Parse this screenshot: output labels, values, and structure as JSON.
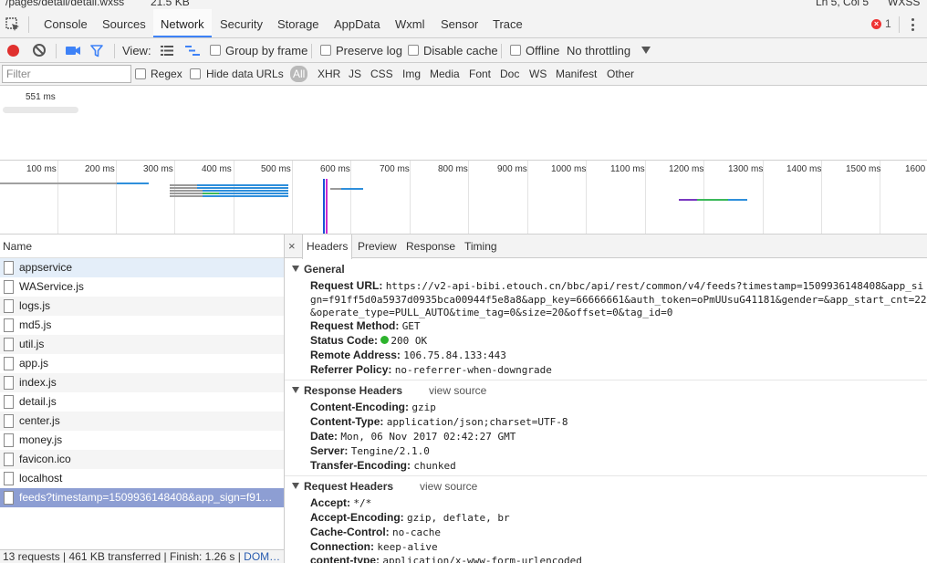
{
  "top_strip": {
    "path": "/pages/detail/detail.wxss",
    "size": "21.5 KB",
    "cursor": "Ln 5, Col 5",
    "lang": "WXSS"
  },
  "tabs": [
    {
      "label": "Console"
    },
    {
      "label": "Sources"
    },
    {
      "label": "Network"
    },
    {
      "label": "Security"
    },
    {
      "label": "Storage"
    },
    {
      "label": "AppData"
    },
    {
      "label": "Wxml"
    },
    {
      "label": "Sensor"
    },
    {
      "label": "Trace"
    }
  ],
  "active_tab": "Network",
  "error_count": "1",
  "error_glyph": "×",
  "toolbar": {
    "view_label": "View:",
    "group_by_frame": "Group by frame",
    "preserve_log": "Preserve log",
    "disable_cache": "Disable cache",
    "offline": "Offline",
    "throttling": "No throttling"
  },
  "filter": {
    "placeholder": "Filter",
    "regex": "Regex",
    "hide_data_urls": "Hide data URLs",
    "all": "All",
    "types": [
      "XHR",
      "JS",
      "CSS",
      "Img",
      "Media",
      "Font",
      "Doc",
      "WS",
      "Manifest",
      "Other"
    ]
  },
  "overview": {
    "label": "551 ms"
  },
  "timeline": {
    "ticks": [
      "100 ms",
      "200 ms",
      "300 ms",
      "400 ms",
      "500 ms",
      "600 ms",
      "700 ms",
      "800 ms",
      "900 ms",
      "1000 ms",
      "1100 ms",
      "1200 ms",
      "1300 ms",
      "1400 ms",
      "1500 ms",
      "1600"
    ]
  },
  "name_header": "Name",
  "requests": [
    {
      "name": "appservice"
    },
    {
      "name": "WAService.js"
    },
    {
      "name": "logs.js"
    },
    {
      "name": "md5.js"
    },
    {
      "name": "util.js"
    },
    {
      "name": "app.js"
    },
    {
      "name": "index.js"
    },
    {
      "name": "detail.js"
    },
    {
      "name": "center.js"
    },
    {
      "name": "money.js"
    },
    {
      "name": "favicon.ico"
    },
    {
      "name": "localhost"
    },
    {
      "name": "feeds?timestamp=1509936148408&app_sign=f91…"
    }
  ],
  "status": {
    "summary": "13 requests | 461 KB transferred | Finish: 1.26 s | ",
    "dom": "DOM…"
  },
  "detail_tabs": {
    "close": "×",
    "headers": "Headers",
    "preview": "Preview",
    "response": "Response",
    "timing": "Timing"
  },
  "general": {
    "title": "General",
    "request_url_key": "Request URL:",
    "request_url_1": "https://v2-api-bibi.etouch.cn/bbc/api/rest/common/v4/feeds?timestamp=1509936148408&app_si",
    "request_url_2": "gn=f91ff5d0a5937d0935bca00944f5e8a8&app_key=66666661&auth_token=oPmUUsuG41181&gender=&app_start_cnt=22",
    "request_url_3": "&operate_type=PULL_AUTO&time_tag=0&size=20&offset=0&tag_id=0",
    "method_key": "Request Method:",
    "method": "GET",
    "status_key": "Status Code:",
    "status": "200 OK",
    "remote_key": "Remote Address:",
    "remote": "106.75.84.133:443",
    "referrer_key": "Referrer Policy:",
    "referrer": "no-referrer-when-downgrade"
  },
  "response_headers": {
    "title": "Response Headers",
    "view_source": "view source",
    "items": [
      {
        "k": "Content-Encoding:",
        "v": "gzip"
      },
      {
        "k": "Content-Type:",
        "v": "application/json;charset=UTF-8"
      },
      {
        "k": "Date:",
        "v": "Mon, 06 Nov 2017 02:42:27 GMT"
      },
      {
        "k": "Server:",
        "v": "Tengine/2.1.0"
      },
      {
        "k": "Transfer-Encoding:",
        "v": "chunked"
      }
    ]
  },
  "request_headers": {
    "title": "Request Headers",
    "view_source": "view source",
    "items": [
      {
        "k": "Accept:",
        "v": "*/*"
      },
      {
        "k": "Accept-Encoding:",
        "v": "gzip, deflate, br"
      },
      {
        "k": "Cache-Control:",
        "v": "no-cache"
      },
      {
        "k": "Connection:",
        "v": "keep-alive"
      },
      {
        "k": "content-type:",
        "v": "application/x-www-form-urlencoded"
      }
    ]
  },
  "colors": {
    "accent": "#3e82f7",
    "selected_row": "#8d9ed3",
    "record": "#e0302e",
    "status_ok": "#2db32d"
  }
}
